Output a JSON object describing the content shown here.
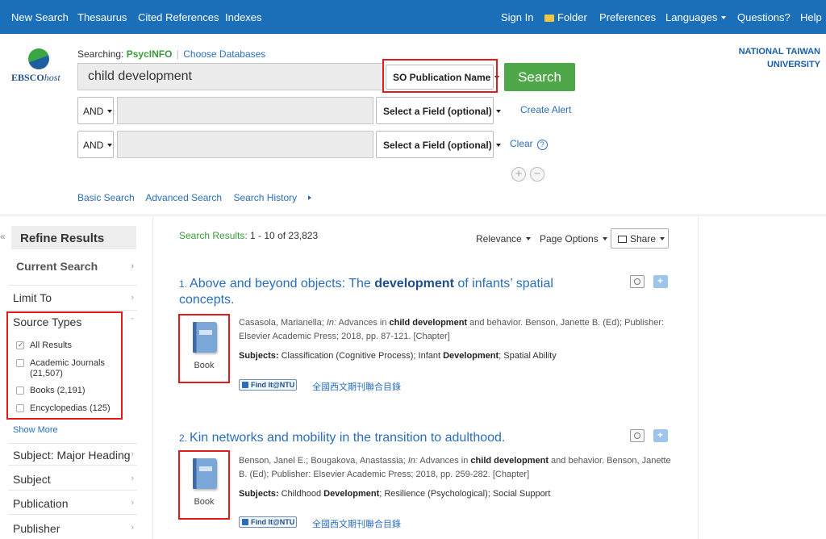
{
  "topnav": {
    "left": [
      "New Search",
      "Thesaurus",
      "Cited References",
      "Indexes"
    ],
    "sign_in": "Sign In",
    "folder": "Folder",
    "preferences": "Preferences",
    "languages": "Languages",
    "questions": "Questions?",
    "help": "Help"
  },
  "header": {
    "logo_main": "EBSCO",
    "logo_host": "host",
    "searching_label": "Searching:",
    "database": "PsycINFO",
    "choose_db": "Choose Databases",
    "institution_line1": "NATIONAL TAIWAN",
    "institution_line2": "UNIVERSITY"
  },
  "search": {
    "query": "child development",
    "field1": "SO Publication Name",
    "bool2": "AND",
    "bool3": "AND",
    "field2": "Select a Field (optional)",
    "field3": "Select a Field (optional)",
    "button": "Search",
    "create_alert": "Create Alert",
    "clear": "Clear",
    "help_glyph": "?",
    "add_glyph": "+",
    "remove_glyph": "−",
    "basic": "Basic Search",
    "advanced": "Advanced Search",
    "history": "Search History"
  },
  "sidebar": {
    "collapse_glyph": "«",
    "title": "Refine Results",
    "current_search": "Current Search",
    "limit_to": "Limit To",
    "source_types": "Source Types",
    "source_options": [
      {
        "label": "All Results",
        "checked": true
      },
      {
        "label": "Academic Journals (21,507)",
        "checked": false
      },
      {
        "label": "Books (2,191)",
        "checked": false
      },
      {
        "label": "Encyclopedias (125)",
        "checked": false
      }
    ],
    "show_more": "Show More",
    "facets": [
      "Subject: Major Heading",
      "Subject",
      "Publication",
      "Publisher"
    ]
  },
  "results": {
    "count_label": "Search Results:",
    "count_value": "1 - 10 of 23,823",
    "relevance": "Relevance",
    "page_options": "Page Options",
    "share": "Share",
    "items": [
      {
        "num": "1.",
        "title_a": "Above and beyond objects: The ",
        "title_b": "development",
        "title_c": " of infants’ spatial concepts.",
        "meta_a": "Casasola, Marianella; ",
        "meta_in": "In:",
        "meta_b": " Advances in ",
        "meta_bold": "child development",
        "meta_c": " and behavior. Benson, Janette B. (Ed); Publisher: Elsevier Academic Press; 2018, pp. 87-121. [Chapter]",
        "subj_label": "Subjects:",
        "subj_a": " Classification (Cognitive Process); Infant ",
        "subj_bold": "Development",
        "subj_b": "; Spatial Ability",
        "type": "Book",
        "findit": "Find It@NTU",
        "cjk": "全國西文期刊聯合目錄"
      },
      {
        "num": "2.",
        "title_a": "Kin networks and mobility in the transition to adulthood.",
        "meta_a": "Benson, Janel E.; Bougakova, Anastassia; ",
        "meta_in": "In:",
        "meta_b": " Advances in ",
        "meta_bold": "child development",
        "meta_c": " and behavior. Benson, Janette B. (Ed); Publisher: Elsevier Academic Press; 2018, pp. 259-282. [Chapter]",
        "subj_label": "Subjects:",
        "subj_a": " Childhood ",
        "subj_bold": "Development",
        "subj_b": "; Resilience (Psychological); Social Support",
        "type": "Book",
        "findit": "Find It@NTU",
        "cjk": "全國西文期刊聯合目錄"
      }
    ]
  },
  "colors": {
    "nav_blue": "#1a6fb8",
    "search_green": "#4ea748",
    "link_blue": "#2a6ebb",
    "highlight_red": "#e21a1a"
  }
}
